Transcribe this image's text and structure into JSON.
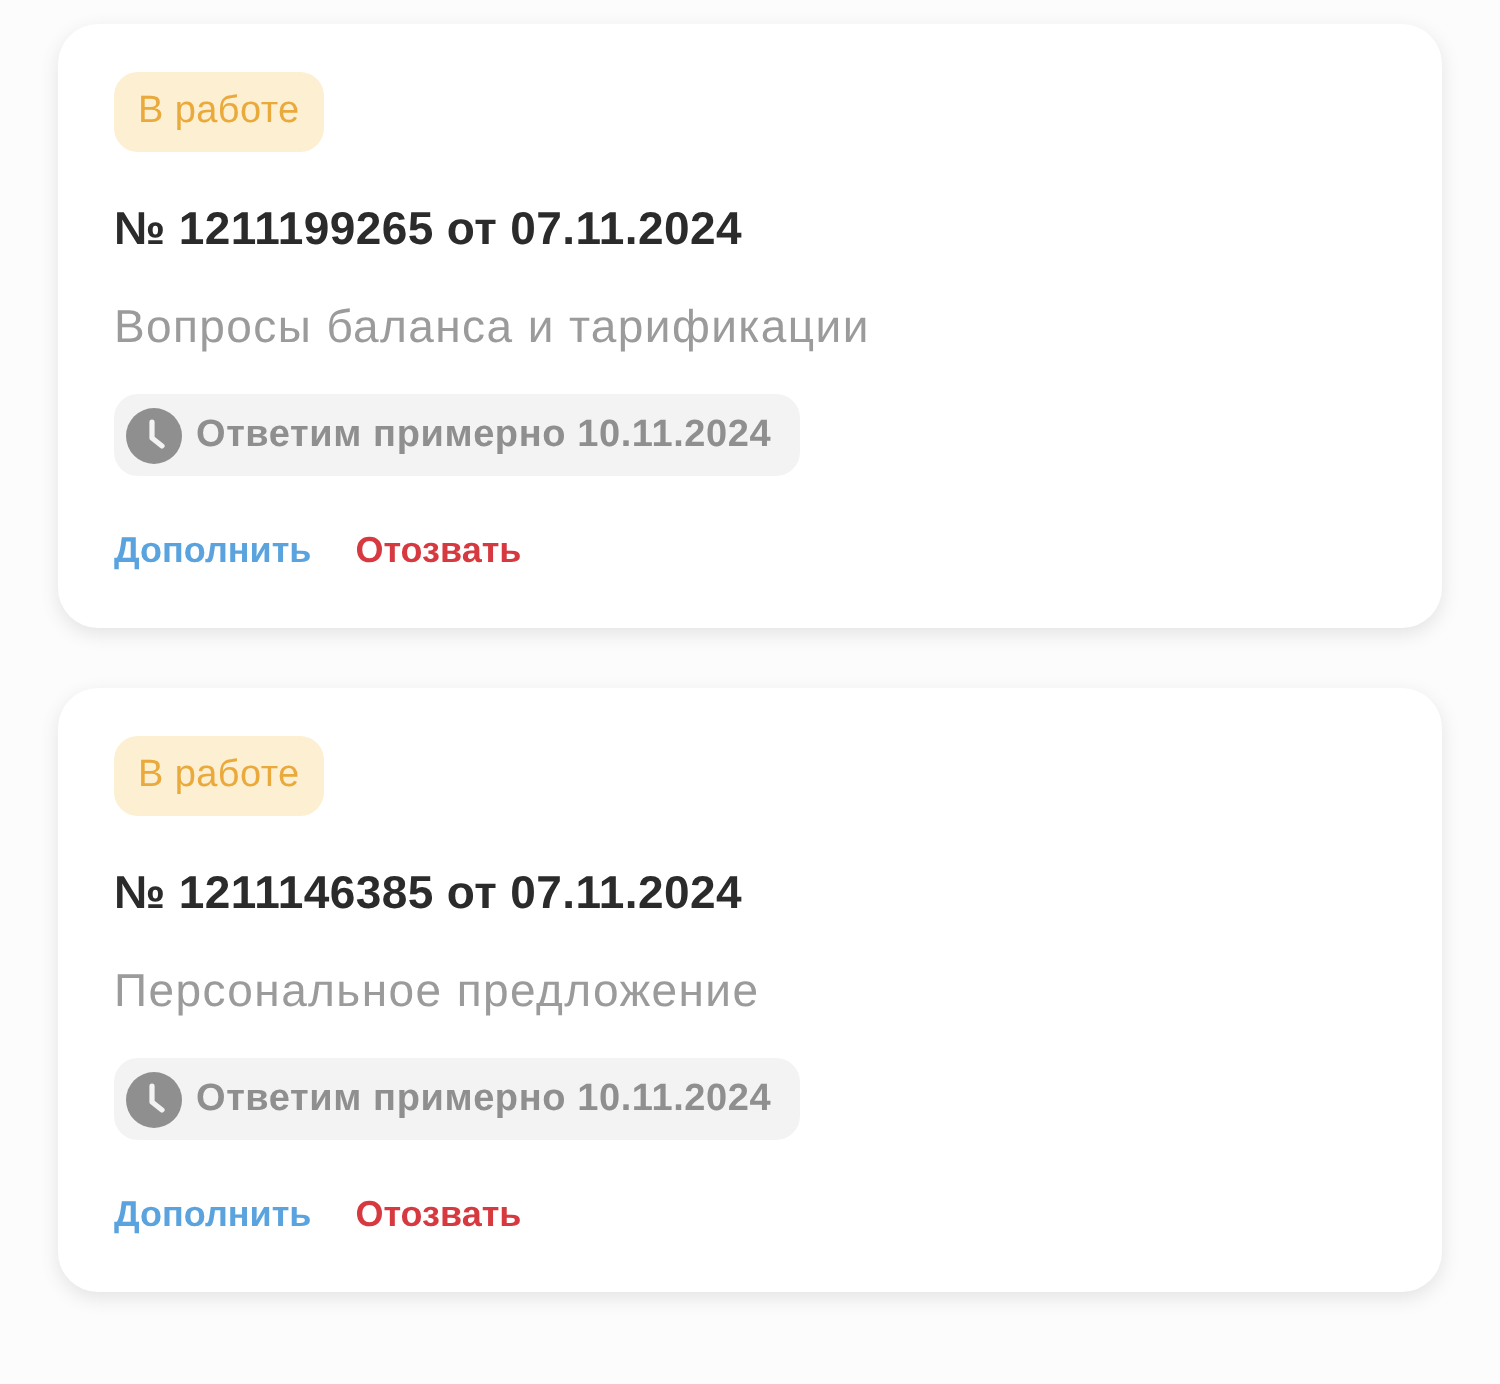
{
  "requests": [
    {
      "status": {
        "label": "В работе",
        "kind": "in_progress"
      },
      "title": "№ 1211199265 от 07.11.2024",
      "topic": "Вопросы баланса и тарификации",
      "eta": "Ответим примерно 10.11.2024",
      "actions": [
        {
          "label": "Дополнить",
          "kind": "add"
        },
        {
          "label": "Отозвать",
          "kind": "withdraw"
        }
      ]
    },
    {
      "status": {
        "label": "В работе",
        "kind": "in_progress"
      },
      "title": "№ 1211146385 от 07.11.2024",
      "topic": "Персональное предложение",
      "eta": "Ответим примерно 10.11.2024",
      "actions": [
        {
          "label": "Дополнить",
          "kind": "add"
        },
        {
          "label": "Отозвать",
          "kind": "withdraw"
        }
      ]
    }
  ]
}
